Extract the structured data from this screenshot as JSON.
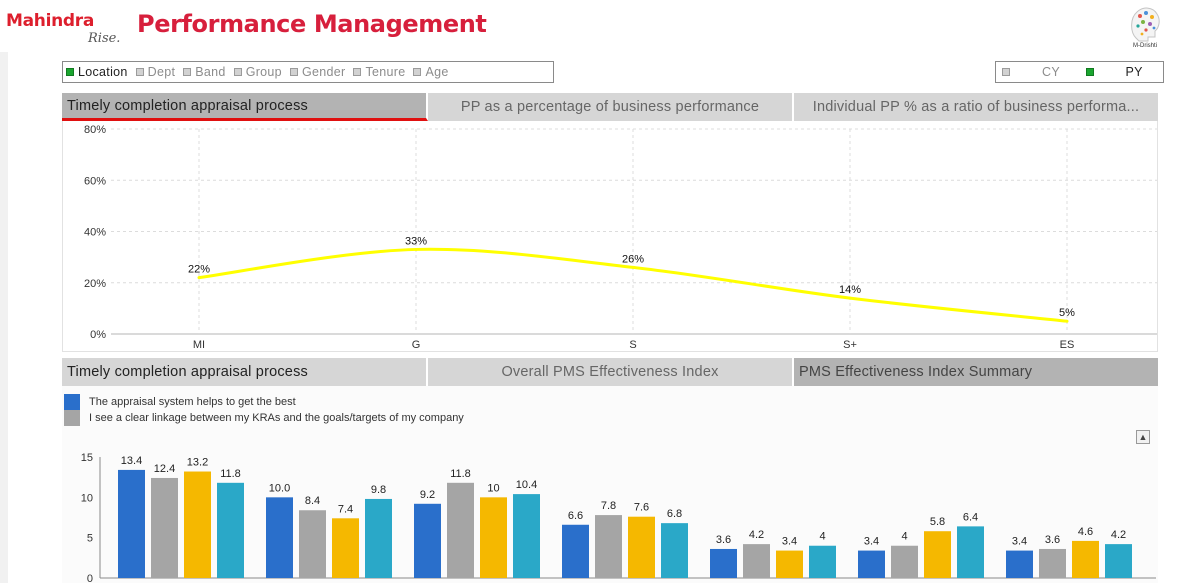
{
  "header": {
    "brand": "Mahindra",
    "brand_tagline": "Rise.",
    "title": "Performance Management",
    "corner_logo_label": "M-Drishti"
  },
  "filters": {
    "dimensions": [
      {
        "label": "Location",
        "active": true
      },
      {
        "label": "Dept",
        "active": false
      },
      {
        "label": "Band",
        "active": false
      },
      {
        "label": "Group",
        "active": false
      },
      {
        "label": "Gender",
        "active": false
      },
      {
        "label": "Tenure",
        "active": false
      },
      {
        "label": "Age",
        "active": false
      }
    ],
    "years": [
      {
        "label": "CY",
        "active": false
      },
      {
        "label": "PY",
        "active": true
      }
    ]
  },
  "top_tabs": [
    {
      "label": "Timely completion appraisal process",
      "active": true
    },
    {
      "label": "PP as a percentage of business performance",
      "active": false
    },
    {
      "label": "Individual PP % as a ratio of business performa...",
      "active": false
    }
  ],
  "bottom_tabs": [
    {
      "label": "Timely completion appraisal process",
      "active": false
    },
    {
      "label": "Overall PMS Effectiveness Index",
      "active": false
    },
    {
      "label": "PMS Effectiveness Index  Summary",
      "active": true
    }
  ],
  "bar_legend": [
    {
      "label": "The appraisal system helps to get the best",
      "color": "#2a6fcb"
    },
    {
      "label": "I see a clear linkage between my KRAs and the goals/targets of my company",
      "color": "#a5a5a5"
    }
  ],
  "scroll_icon": "caret-up-icon",
  "chart_data": [
    {
      "type": "line",
      "x": [
        "MI",
        "G",
        "S",
        "S+",
        "ES"
      ],
      "series": [
        {
          "values": [
            22,
            33,
            26,
            14,
            5
          ],
          "labels": [
            "22%",
            "33%",
            "26%",
            "14%",
            "5%"
          ],
          "color": "#ffff00"
        }
      ],
      "y_ticks": [
        "80%",
        "60%",
        "40%",
        "20%",
        "0%"
      ],
      "ylim": [
        0,
        80
      ],
      "grid": true
    },
    {
      "type": "bar",
      "groups": 7,
      "series_colors": [
        "#2a6fcb",
        "#a5a5a5",
        "#f5b800",
        "#2aa8c8"
      ],
      "values": [
        [
          13.4,
          12.4,
          13.2,
          11.8
        ],
        [
          10.0,
          8.4,
          7.4,
          9.8
        ],
        [
          9.2,
          11.8,
          10,
          10.4
        ],
        [
          6.6,
          7.8,
          7.6,
          6.8
        ],
        [
          3.6,
          4.2,
          3.4,
          4
        ],
        [
          3.4,
          4,
          5.8,
          6.4
        ],
        [
          3.4,
          3.6,
          4.6,
          4.2
        ]
      ],
      "labels": [
        [
          "13.4",
          "12.4",
          "13.2",
          "11.8"
        ],
        [
          "10.0",
          "8.4",
          "7.4",
          "9.8"
        ],
        [
          "9.2",
          "11.8",
          "10",
          "10.4"
        ],
        [
          "6.6",
          "7.8",
          "7.6",
          "6.8"
        ],
        [
          "3.6",
          "4.2",
          "3.4",
          "4"
        ],
        [
          "3.4",
          "4",
          "5.8",
          "6.4"
        ],
        [
          "3.4",
          "3.6",
          "4.6",
          "4.2"
        ]
      ],
      "y_ticks": [
        "15",
        "10",
        "5",
        "0"
      ],
      "ylim": [
        0,
        15
      ]
    }
  ]
}
